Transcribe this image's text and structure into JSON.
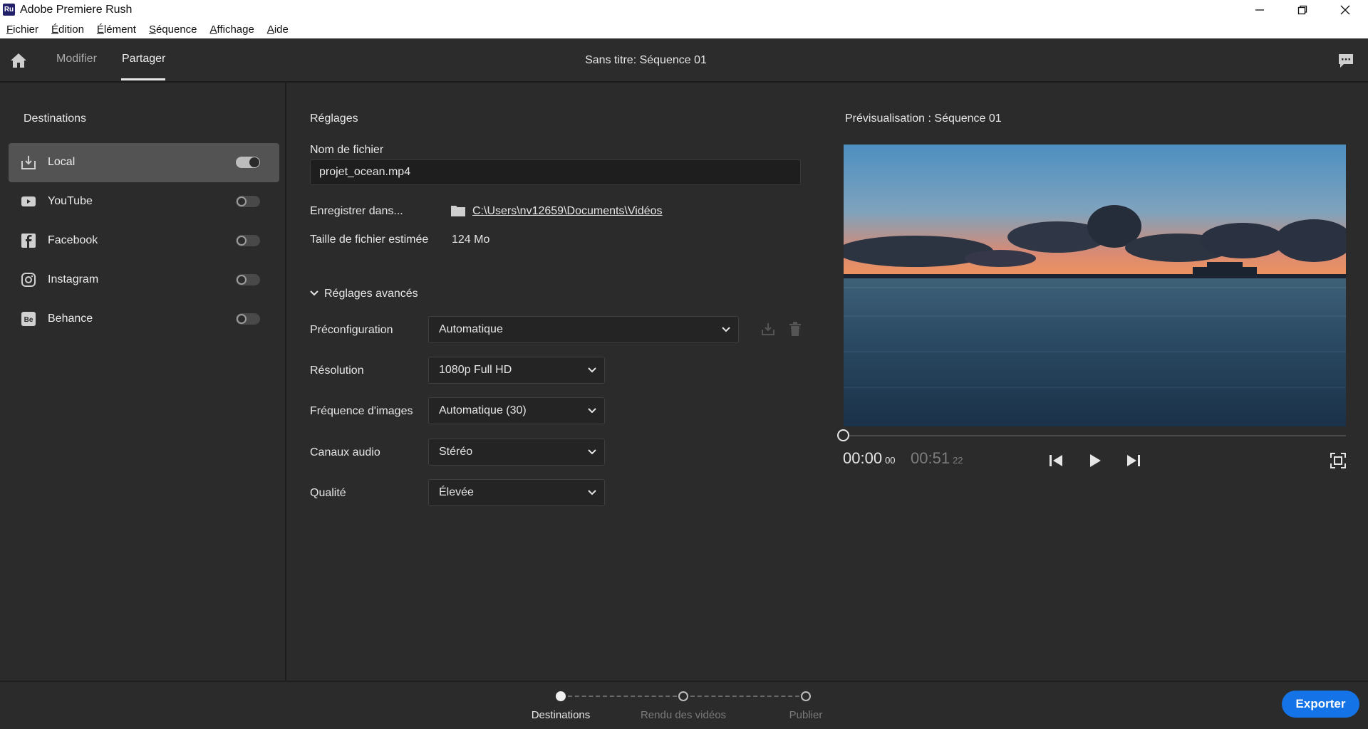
{
  "app": {
    "logo_text": "Ru",
    "title": "Adobe Premiere Rush"
  },
  "window_controls": {
    "minimize": "—",
    "restore": "❐",
    "close": "✕"
  },
  "menu": [
    "Fichier",
    "Édition",
    "Élément",
    "Séquence",
    "Affichage",
    "Aide"
  ],
  "nav": {
    "tabs": [
      {
        "label": "Modifier",
        "active": false
      },
      {
        "label": "Partager",
        "active": true
      }
    ],
    "sequence_title": "Sans titre: Séquence  01"
  },
  "sidebar": {
    "title": "Destinations",
    "items": [
      {
        "label": "Local",
        "icon": "local-download-icon",
        "enabled": true,
        "selected": true
      },
      {
        "label": "YouTube",
        "icon": "youtube-icon",
        "enabled": false,
        "selected": false
      },
      {
        "label": "Facebook",
        "icon": "facebook-icon",
        "enabled": false,
        "selected": false
      },
      {
        "label": "Instagram",
        "icon": "instagram-icon",
        "enabled": false,
        "selected": false
      },
      {
        "label": "Behance",
        "icon": "behance-icon",
        "enabled": false,
        "selected": false
      }
    ]
  },
  "settings": {
    "title": "Réglages",
    "filename_label": "Nom de fichier",
    "filename_value": "projet_ocean.mp4",
    "save_in_label": "Enregistrer dans...",
    "save_path": "C:\\Users\\nv12659\\Documents\\Vidéos",
    "size_label": "Taille de fichier estimée",
    "size_value": "124 Mo",
    "advanced_label": "Réglages avancés",
    "preset_label": "Préconfiguration",
    "preset_value": "Automatique",
    "resolution_label": "Résolution",
    "resolution_value": "1080p Full HD",
    "framerate_label": "Fréquence d'images",
    "framerate_value": "Automatique (30)",
    "audio_label": "Canaux audio",
    "audio_value": "Stéréo",
    "quality_label": "Qualité",
    "quality_value": "Élevée"
  },
  "preview": {
    "title": "Prévisualisation : Séquence  01",
    "current_time": "00:00",
    "current_frames": "00",
    "total_time": "00:51",
    "total_frames": "22",
    "playhead_position": 0.0
  },
  "steps": [
    {
      "label": "Destinations",
      "active": true
    },
    {
      "label": "Rendu des vidéos",
      "active": false
    },
    {
      "label": "Publier",
      "active": false
    }
  ],
  "export_label": "Exporter",
  "colors": {
    "accent": "#1473e6",
    "background": "#2b2b2b",
    "selected_item": "#535353"
  }
}
